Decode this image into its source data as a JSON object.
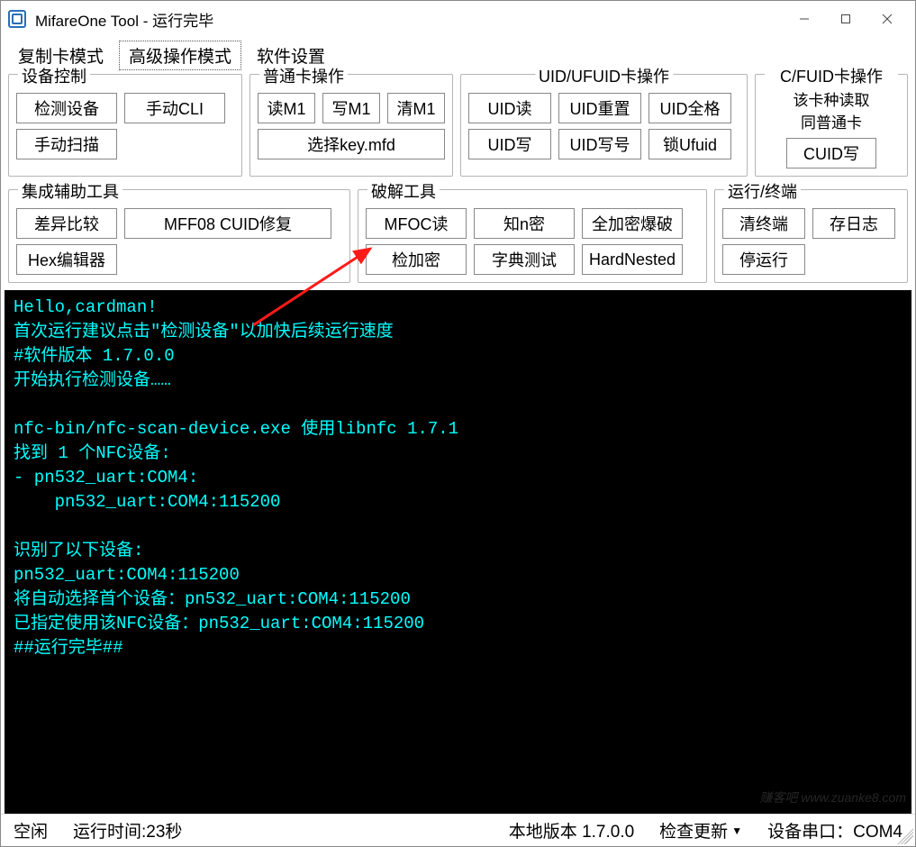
{
  "titlebar": {
    "title": "MifareOne Tool - 运行完毕"
  },
  "tabs": {
    "copy_mode": "复制卡模式",
    "advanced_mode": "高级操作模式",
    "settings": "软件设置"
  },
  "groups": {
    "device": {
      "legend": "设备控制",
      "detect": "检测设备",
      "manual_cli": "手动CLI",
      "manual_scan": "手动扫描"
    },
    "normal": {
      "legend": "普通卡操作",
      "read_m1": "读M1",
      "write_m1": "写M1",
      "clear_m1": "清M1",
      "select_key": "选择key.mfd"
    },
    "uid": {
      "legend": "UID/UFUID卡操作",
      "uid_read": "UID读",
      "uid_reset": "UID重置",
      "uid_full": "UID全格",
      "uid_write": "UID写",
      "uid_write_no": "UID写号",
      "lock_ufuid": "锁Ufuid"
    },
    "cfuid": {
      "legend": "C/FUID卡操作",
      "sublabel": "该卡种读取\n同普通卡",
      "cuid_write": "CUID写"
    },
    "aux": {
      "legend": "集成辅助工具",
      "diff": "差异比较",
      "mff08": "MFF08 CUID修复",
      "hex_editor": "Hex编辑器"
    },
    "crack": {
      "legend": "破解工具",
      "mfoc_read": "MFOC读",
      "know_n": "知n密",
      "full_brute": "全加密爆破",
      "check_enc": "检加密",
      "dict_test": "字典测试",
      "hardnested": "HardNested"
    },
    "run": {
      "legend": "运行/终端",
      "clear_term": "清终端",
      "save_log": "存日志",
      "stop_run": "停运行"
    }
  },
  "terminal_lines": [
    "Hello,cardman!",
    "首次运行建议点击\"检测设备\"以加快后续运行速度",
    "#软件版本 1.7.0.0",
    "开始执行检测设备……",
    "",
    "nfc-bin/nfc-scan-device.exe 使用libnfc 1.7.1",
    "找到 1 个NFC设备:",
    "- pn532_uart:COM4:",
    "    pn532_uart:COM4:115200",
    "",
    "识别了以下设备:",
    "pn532_uart:COM4:115200",
    "将自动选择首个设备：pn532_uart:COM4:115200",
    "已指定使用该NFC设备：pn532_uart:COM4:115200",
    "##运行完毕##"
  ],
  "watermark": "赚客吧 www.zuanke8.com",
  "statusbar": {
    "idle": "空闲",
    "runtime_label": "运行时间:",
    "runtime_value": "23秒",
    "local_version_label": "本地版本",
    "local_version_value": "1.7.0.0",
    "check_update": "检查更新",
    "serial_label": "设备串口：",
    "serial_value": "COM4"
  }
}
